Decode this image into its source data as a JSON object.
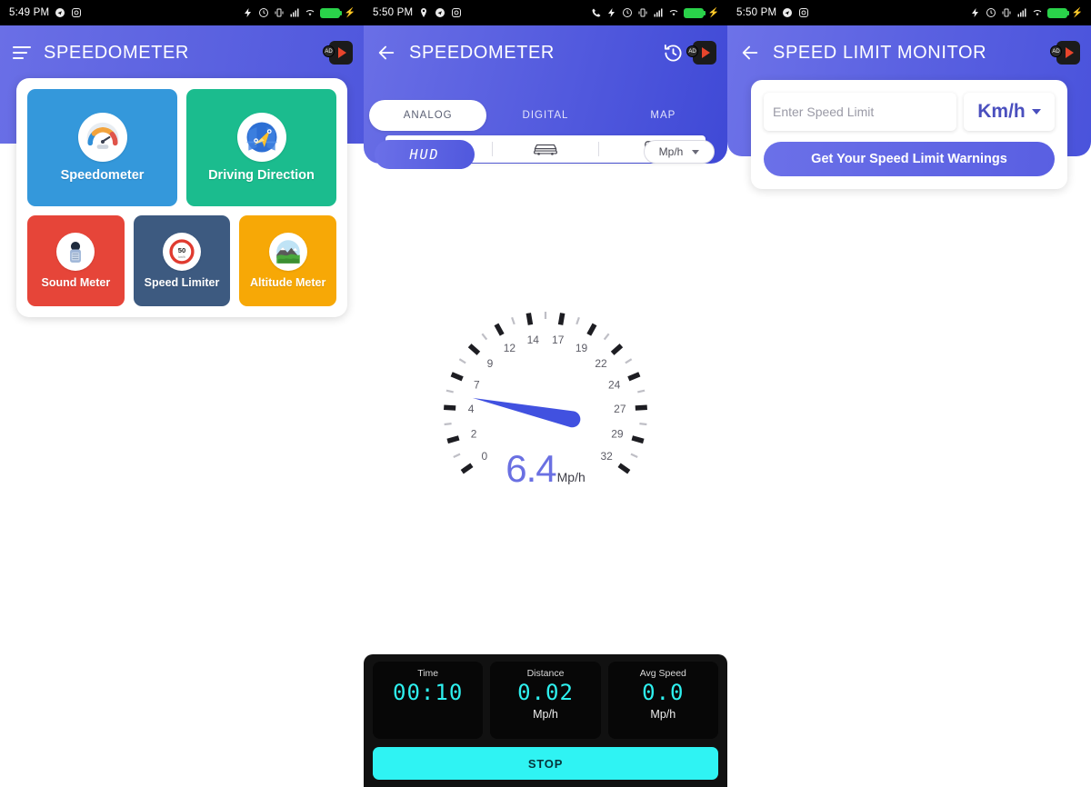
{
  "status_bars": [
    {
      "time": "5:49 PM",
      "left_icons": [
        "telegram-icon",
        "instagram-icon"
      ],
      "right_icons": [
        "vpn-icon",
        "alarm-icon",
        "vibrate-icon",
        "signal-icon",
        "wifi-icon"
      ],
      "battery_charging": true
    },
    {
      "time": "5:50 PM",
      "left_icons": [
        "location-icon",
        "telegram-icon",
        "instagram-icon"
      ],
      "right_icons": [
        "call-icon",
        "vpn-icon",
        "alarm-icon",
        "vibrate-icon",
        "signal-icon",
        "wifi-icon"
      ],
      "battery_charging": true
    },
    {
      "time": "5:50 PM",
      "left_icons": [
        "telegram-icon",
        "instagram-icon"
      ],
      "right_icons": [
        "vpn-icon",
        "alarm-icon",
        "vibrate-icon",
        "signal-icon",
        "wifi-icon"
      ],
      "battery_charging": true
    }
  ],
  "colors": {
    "brand_purple": "#5a61e1",
    "brand_purple_dark": "#4a53dc",
    "tile_blue": "#3498db",
    "tile_green": "#1bbc8e",
    "tile_red": "#e64539",
    "tile_navy": "#3d5a80",
    "tile_amber": "#f7a806",
    "cyan": "#2ff3f3",
    "needle": "#4151e0",
    "speed_text": "#6a70e2"
  },
  "screen1": {
    "title": "SPEEDOMETER",
    "menu_icon": "hamburger-icon",
    "ad_badge": "ad-badge-icon",
    "tiles_large": [
      {
        "label": "Speedometer",
        "icon": "speedometer-gauge-icon",
        "color": "#3498db"
      },
      {
        "label": "Driving Direction",
        "icon": "compass-map-icon",
        "color": "#1bbc8e"
      }
    ],
    "tiles_small": [
      {
        "label": "Sound Meter",
        "icon": "microphone-icon",
        "color": "#e64539"
      },
      {
        "label": "Speed Limiter",
        "icon": "speed-limit-sign-icon",
        "color": "#3d5a80",
        "sign_value": "50"
      },
      {
        "label": "Altitude Meter",
        "icon": "mountain-icon",
        "color": "#f7a806"
      }
    ]
  },
  "screen2": {
    "title": "SPEEDOMETER",
    "back_icon": "back-arrow-icon",
    "history_icon": "history-clock-icon",
    "ad_badge": "ad-badge-icon",
    "tabs": [
      {
        "label": "ANALOG",
        "active": true
      },
      {
        "label": "DIGITAL",
        "active": false
      },
      {
        "label": "MAP",
        "active": false
      }
    ],
    "vehicle_modes": [
      {
        "icon": "bicycle-icon",
        "active": true
      },
      {
        "icon": "car-icon",
        "active": false
      },
      {
        "icon": "train-icon",
        "active": false
      }
    ],
    "hud_button": "HUD",
    "unit_selector": "Mp/h",
    "speed_value": "6.4",
    "speed_unit": "Mp/h",
    "gauge": {
      "labels": [
        "0",
        "2",
        "4",
        "7",
        "9",
        "12",
        "14",
        "17",
        "19",
        "22",
        "24",
        "27",
        "29",
        "32"
      ],
      "min": 0,
      "max": 34,
      "needle_value": 6.4,
      "major_ticks": 14,
      "minor_ticks": 14
    },
    "stats": [
      {
        "label": "Time",
        "value": "00:10",
        "unit": ""
      },
      {
        "label": "Distance",
        "value": "0.02",
        "unit": "Mp/h"
      },
      {
        "label": "Avg Speed",
        "value": "0.0",
        "unit": "Mp/h"
      }
    ],
    "stop_button": "STOP"
  },
  "screen3": {
    "title": "SPEED LIMIT MONITOR",
    "back_icon": "back-arrow-icon",
    "ad_badge": "ad-badge-icon",
    "input_placeholder": "Enter Speed Limit",
    "input_value": "",
    "unit_selected": "Km/h",
    "submit_label": "Get Your Speed Limit Warnings"
  }
}
